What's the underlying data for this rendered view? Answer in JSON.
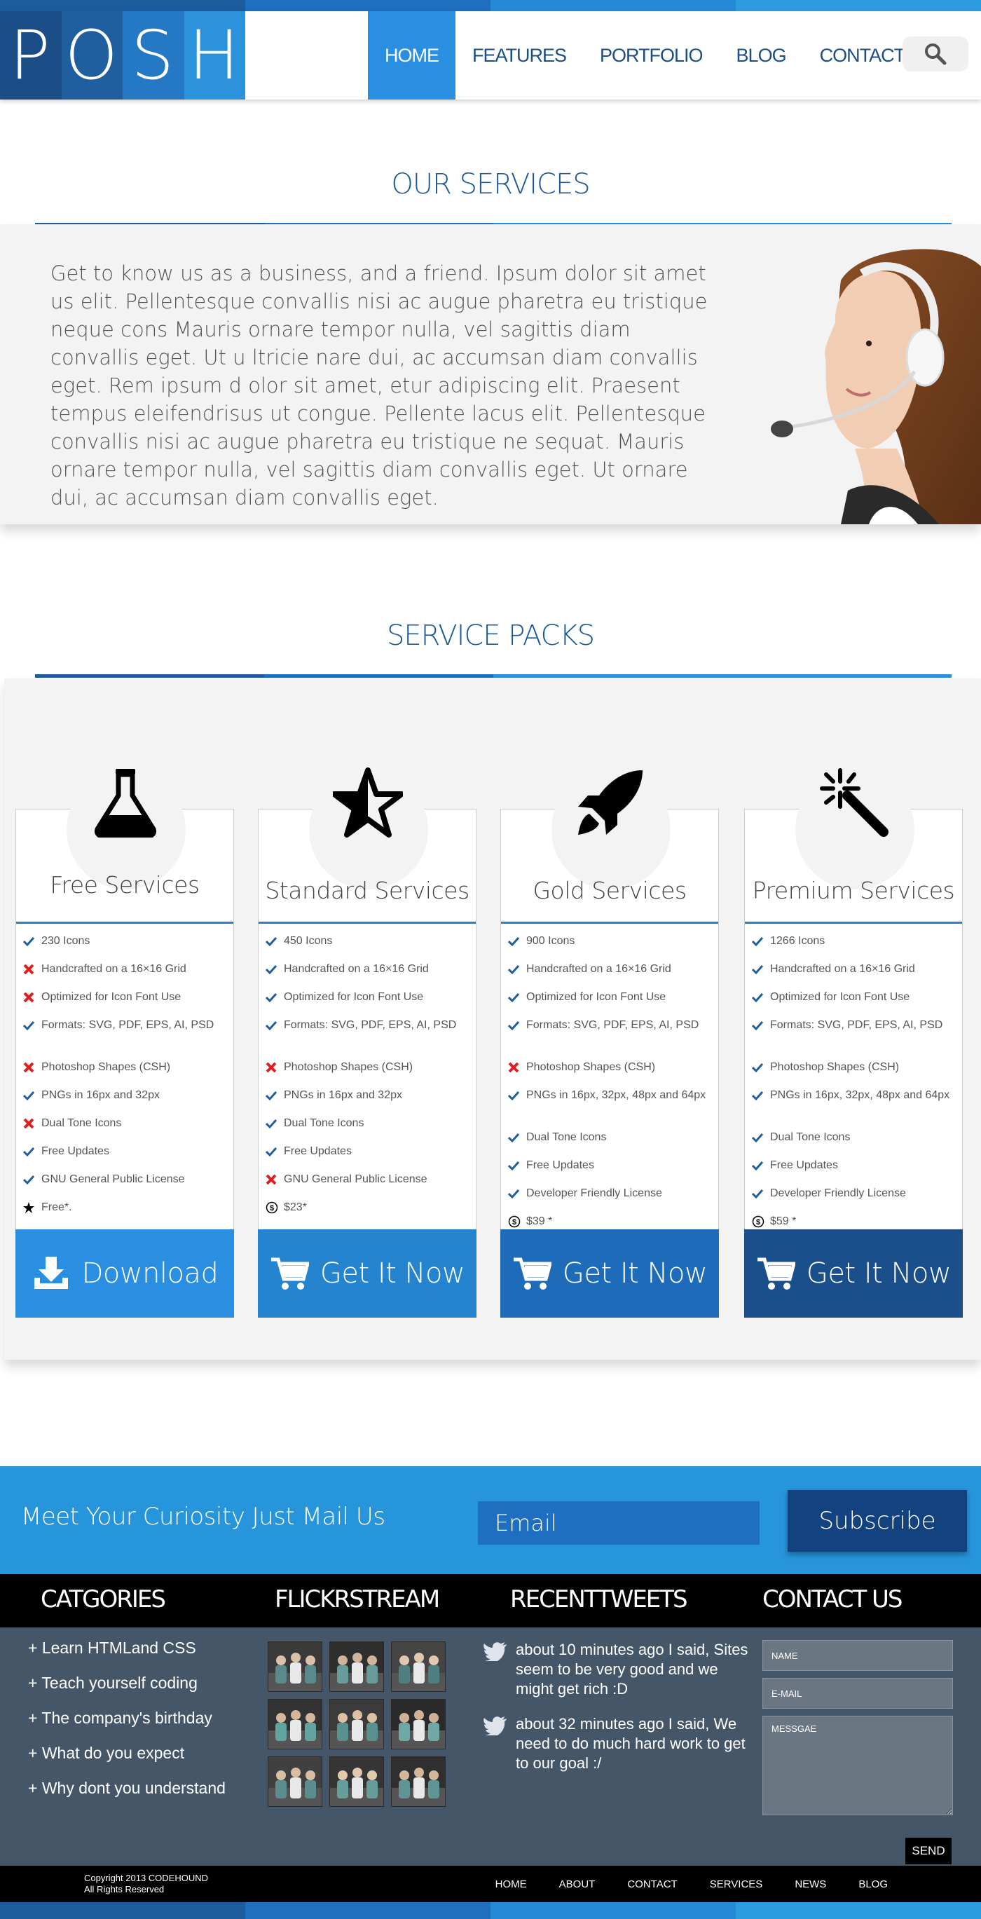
{
  "brand": {
    "logo_letters": [
      "P",
      "O",
      "S",
      "H"
    ]
  },
  "nav": {
    "items": [
      {
        "label": "HOME",
        "active": true
      },
      {
        "label": "FEATURES",
        "active": false
      },
      {
        "label": "PORTFOLIO",
        "active": false
      },
      {
        "label": "BLOG",
        "active": false
      },
      {
        "label": "CONTACT",
        "active": false
      }
    ]
  },
  "services": {
    "title": "OUR SERVICES",
    "text": "Get to know us as a business, and a friend. Ipsum dolor sit amet us elit. Pellentesque convallis  nisi ac augue pharetra eu tristique neque cons Mauris ornare tempor nulla, vel sagittis diam convallis eget. Ut u ltricie nare dui, ac accumsan diam convallis eget. Rem ipsum d olor sit amet, etur adipiscing elit. Praesent tempus eleifendrisus ut congue. Pellente lacus elit. Pellentesque convallis nisi ac augue pharetra eu tristique ne sequat. Mauris ornare tempor nulla, vel sagittis diam convallis eget. Ut ornare dui, ac accumsan diam convallis eget."
  },
  "packs": {
    "title": "SERVICE PACKS",
    "cards": [
      {
        "title": "Free Services",
        "icon": "flask-icon",
        "button": "Download",
        "button_icon": "download-icon",
        "button_color": "#2a8fe0",
        "features": [
          {
            "text": "230 Icons",
            "mark": "check"
          },
          {
            "text": "Handcrafted on a 16×16 Grid",
            "mark": "cross"
          },
          {
            "text": "Optimized for Icon Font Use",
            "mark": "cross"
          },
          {
            "text": "Formats: SVG, PDF, EPS, AI, PSD",
            "mark": "check"
          },
          {
            "text": "Photoshop Shapes (CSH)",
            "mark": "cross"
          },
          {
            "text": "PNGs in 16px and 32px",
            "mark": "check"
          },
          {
            "text": "Dual Tone Icons",
            "mark": "cross"
          },
          {
            "text": "Free Updates",
            "mark": "check"
          },
          {
            "text": "GNU General Public License",
            "mark": "check"
          },
          {
            "text": "Free*.",
            "mark": "star"
          }
        ]
      },
      {
        "title": "Standard Services",
        "icon": "star-icon",
        "button": "Get It Now",
        "button_icon": "cart-icon",
        "button_color": "#2584d0",
        "features": [
          {
            "text": "450 Icons",
            "mark": "check"
          },
          {
            "text": "Handcrafted on a 16×16 Grid",
            "mark": "check"
          },
          {
            "text": "Optimized for Icon Font Use",
            "mark": "check"
          },
          {
            "text": "Formats: SVG, PDF, EPS, AI, PSD",
            "mark": "check"
          },
          {
            "text": "Photoshop Shapes (CSH)",
            "mark": "cross"
          },
          {
            "text": "PNGs in 16px and 32px",
            "mark": "check"
          },
          {
            "text": "Dual Tone Icons",
            "mark": "check"
          },
          {
            "text": "Free Updates",
            "mark": "check"
          },
          {
            "text": "GNU General Public License",
            "mark": "cross"
          },
          {
            "text": "$23*",
            "mark": "dollar"
          }
        ]
      },
      {
        "title": "Gold Services",
        "icon": "rocket-icon",
        "button": "Get It Now",
        "button_icon": "cart-icon",
        "button_color": "#1e6cb9",
        "features": [
          {
            "text": "900 Icons",
            "mark": "check"
          },
          {
            "text": "Handcrafted on a 16×16 Grid",
            "mark": "check"
          },
          {
            "text": "Optimized for Icon Font Use",
            "mark": "check"
          },
          {
            "text": "Formats: SVG, PDF, EPS, AI, PSD",
            "mark": "check"
          },
          {
            "text": "Photoshop Shapes (CSH)",
            "mark": "cross"
          },
          {
            "text": "PNGs in 16px, 32px, 48px and 64px",
            "mark": "check"
          },
          {
            "text": "Dual Tone Icons",
            "mark": "check"
          },
          {
            "text": "Free Updates",
            "mark": "check"
          },
          {
            "text": "Developer Friendly License",
            "mark": "check"
          },
          {
            "text": "$39 *",
            "mark": "dollar"
          }
        ]
      },
      {
        "title": "Premium Services",
        "icon": "magic-wand-icon",
        "button": "Get It Now",
        "button_icon": "cart-icon",
        "button_color": "#1a4f8c",
        "features": [
          {
            "text": "1266 Icons",
            "mark": "check"
          },
          {
            "text": "Handcrafted on a 16×16 Grid",
            "mark": "check"
          },
          {
            "text": "Optimized for Icon Font Use",
            "mark": "check"
          },
          {
            "text": "Formats: SVG, PDF, EPS, AI, PSD",
            "mark": "check"
          },
          {
            "text": "Photoshop Shapes (CSH)",
            "mark": "check"
          },
          {
            "text": "PNGs in 16px, 32px, 48px and 64px",
            "mark": "check"
          },
          {
            "text": "Dual Tone Icons",
            "mark": "check"
          },
          {
            "text": "Free Updates",
            "mark": "check"
          },
          {
            "text": "Developer Friendly License",
            "mark": "check"
          },
          {
            "text": "$59 *",
            "mark": "dollar"
          }
        ]
      }
    ]
  },
  "newsletter": {
    "text": "Meet Your Curiosity Just Mail Us",
    "placeholder": "Email",
    "button": "Subscribe"
  },
  "footer": {
    "categories_title": "CATGORIES",
    "flickr_title": "FLICKRSTREAM",
    "tweets_title": "RECENTTWEETS",
    "contact_title": "CONTACT US",
    "categories": [
      "+ Learn HTMLand CSS",
      "+ Teach yourself coding",
      "+ The company's birthday",
      "+ What do you expect",
      "+ Why dont you understand"
    ],
    "tweets": [
      "about 10 minutes ago I said, Sites seem to be very good and we might get rich :D",
      "about 32 minutes ago I said, We need to do much hard work to get to our goal :/"
    ],
    "form": {
      "name_placeholder": "NAME",
      "email_placeholder": "E-MAIL",
      "message_placeholder": "MESSGAE",
      "send": "SEND"
    },
    "copyright_line1": "Copyright 2013 CODEHOUND",
    "copyright_line2": "All Rights Reserved",
    "bottom_nav": [
      "HOME",
      "ABOUT",
      "CONTACT",
      "SERVICES",
      "NEWS",
      "BLOG"
    ]
  },
  "colors": {
    "brand_dark": "#1b4d86",
    "brand_blue": "#2a8fe0",
    "check": "#1f5fa0",
    "cross": "#e02020",
    "footer_bg": "#465669"
  }
}
